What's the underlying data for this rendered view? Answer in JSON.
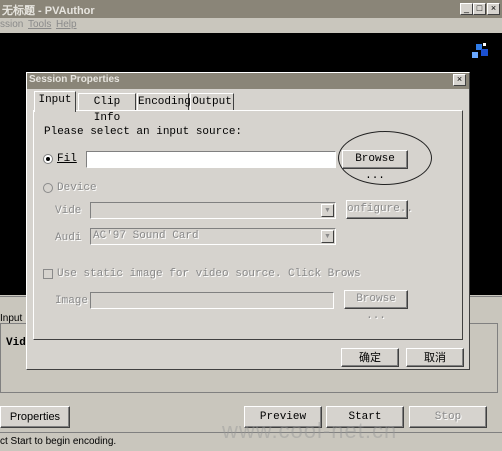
{
  "main_window": {
    "title": "无标题 - PVAuthor",
    "menu": [
      "ssion",
      "Tools",
      "Help"
    ],
    "input_label": "Input",
    "vid_label": "Vid",
    "properties_button": "Properties",
    "preview_button": "Preview",
    "start_button": "Start",
    "stop_button": "Stop",
    "status_text": "ct Start to begin encoding."
  },
  "dialog": {
    "title": "Session Properties",
    "close_glyph": "×",
    "tabs": [
      {
        "label": "Input",
        "active": true
      },
      {
        "label": "Clip Info",
        "active": false
      },
      {
        "label": "Encoding",
        "active": false
      },
      {
        "label": "Output",
        "active": false
      }
    ],
    "prompt": "Please select an input source:",
    "file_option_label": "Fil",
    "file_value": "",
    "browse_button": "Browse ...",
    "device_option_label": "Device",
    "video_label": "Vide",
    "video_value": "",
    "configure_button": "onfigure..",
    "audio_label": "Audi",
    "audio_value": "AC'97 Sound Card",
    "static_image_checkbox_label": "Use static image for video source. Click Brows",
    "image_label": "Image",
    "image_value": "",
    "browse2_button": "Browse ...",
    "ok_button": "确定",
    "cancel_button": "取消"
  },
  "watermark": "www.cool-net.cn",
  "colors": {
    "title_bar": "#8a8578",
    "preview_area": "#000000",
    "dialog_face": "#d6d3ce",
    "window_face": "#c9c6bd"
  }
}
